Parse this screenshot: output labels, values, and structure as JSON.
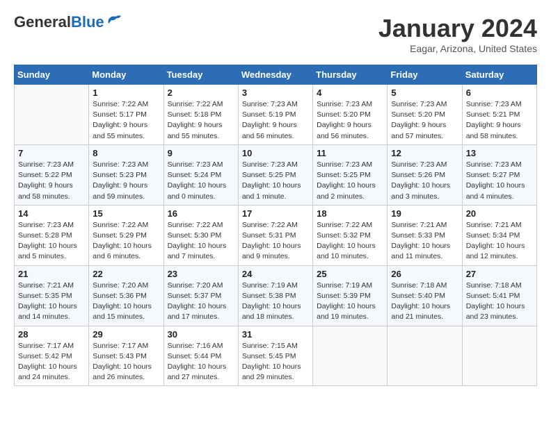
{
  "header": {
    "logo_general": "General",
    "logo_blue": "Blue",
    "title": "January 2024",
    "location": "Eagar, Arizona, United States"
  },
  "calendar": {
    "days_of_week": [
      "Sunday",
      "Monday",
      "Tuesday",
      "Wednesday",
      "Thursday",
      "Friday",
      "Saturday"
    ],
    "weeks": [
      [
        {
          "day": "",
          "info": ""
        },
        {
          "day": "1",
          "info": "Sunrise: 7:22 AM\nSunset: 5:17 PM\nDaylight: 9 hours\nand 55 minutes."
        },
        {
          "day": "2",
          "info": "Sunrise: 7:22 AM\nSunset: 5:18 PM\nDaylight: 9 hours\nand 55 minutes."
        },
        {
          "day": "3",
          "info": "Sunrise: 7:23 AM\nSunset: 5:19 PM\nDaylight: 9 hours\nand 56 minutes."
        },
        {
          "day": "4",
          "info": "Sunrise: 7:23 AM\nSunset: 5:20 PM\nDaylight: 9 hours\nand 56 minutes."
        },
        {
          "day": "5",
          "info": "Sunrise: 7:23 AM\nSunset: 5:20 PM\nDaylight: 9 hours\nand 57 minutes."
        },
        {
          "day": "6",
          "info": "Sunrise: 7:23 AM\nSunset: 5:21 PM\nDaylight: 9 hours\nand 58 minutes."
        }
      ],
      [
        {
          "day": "7",
          "info": "Sunrise: 7:23 AM\nSunset: 5:22 PM\nDaylight: 9 hours\nand 58 minutes."
        },
        {
          "day": "8",
          "info": "Sunrise: 7:23 AM\nSunset: 5:23 PM\nDaylight: 9 hours\nand 59 minutes."
        },
        {
          "day": "9",
          "info": "Sunrise: 7:23 AM\nSunset: 5:24 PM\nDaylight: 10 hours\nand 0 minutes."
        },
        {
          "day": "10",
          "info": "Sunrise: 7:23 AM\nSunset: 5:25 PM\nDaylight: 10 hours\nand 1 minute."
        },
        {
          "day": "11",
          "info": "Sunrise: 7:23 AM\nSunset: 5:25 PM\nDaylight: 10 hours\nand 2 minutes."
        },
        {
          "day": "12",
          "info": "Sunrise: 7:23 AM\nSunset: 5:26 PM\nDaylight: 10 hours\nand 3 minutes."
        },
        {
          "day": "13",
          "info": "Sunrise: 7:23 AM\nSunset: 5:27 PM\nDaylight: 10 hours\nand 4 minutes."
        }
      ],
      [
        {
          "day": "14",
          "info": "Sunrise: 7:23 AM\nSunset: 5:28 PM\nDaylight: 10 hours\nand 5 minutes."
        },
        {
          "day": "15",
          "info": "Sunrise: 7:22 AM\nSunset: 5:29 PM\nDaylight: 10 hours\nand 6 minutes."
        },
        {
          "day": "16",
          "info": "Sunrise: 7:22 AM\nSunset: 5:30 PM\nDaylight: 10 hours\nand 7 minutes."
        },
        {
          "day": "17",
          "info": "Sunrise: 7:22 AM\nSunset: 5:31 PM\nDaylight: 10 hours\nand 9 minutes."
        },
        {
          "day": "18",
          "info": "Sunrise: 7:22 AM\nSunset: 5:32 PM\nDaylight: 10 hours\nand 10 minutes."
        },
        {
          "day": "19",
          "info": "Sunrise: 7:21 AM\nSunset: 5:33 PM\nDaylight: 10 hours\nand 11 minutes."
        },
        {
          "day": "20",
          "info": "Sunrise: 7:21 AM\nSunset: 5:34 PM\nDaylight: 10 hours\nand 12 minutes."
        }
      ],
      [
        {
          "day": "21",
          "info": "Sunrise: 7:21 AM\nSunset: 5:35 PM\nDaylight: 10 hours\nand 14 minutes."
        },
        {
          "day": "22",
          "info": "Sunrise: 7:20 AM\nSunset: 5:36 PM\nDaylight: 10 hours\nand 15 minutes."
        },
        {
          "day": "23",
          "info": "Sunrise: 7:20 AM\nSunset: 5:37 PM\nDaylight: 10 hours\nand 17 minutes."
        },
        {
          "day": "24",
          "info": "Sunrise: 7:19 AM\nSunset: 5:38 PM\nDaylight: 10 hours\nand 18 minutes."
        },
        {
          "day": "25",
          "info": "Sunrise: 7:19 AM\nSunset: 5:39 PM\nDaylight: 10 hours\nand 19 minutes."
        },
        {
          "day": "26",
          "info": "Sunrise: 7:18 AM\nSunset: 5:40 PM\nDaylight: 10 hours\nand 21 minutes."
        },
        {
          "day": "27",
          "info": "Sunrise: 7:18 AM\nSunset: 5:41 PM\nDaylight: 10 hours\nand 23 minutes."
        }
      ],
      [
        {
          "day": "28",
          "info": "Sunrise: 7:17 AM\nSunset: 5:42 PM\nDaylight: 10 hours\nand 24 minutes."
        },
        {
          "day": "29",
          "info": "Sunrise: 7:17 AM\nSunset: 5:43 PM\nDaylight: 10 hours\nand 26 minutes."
        },
        {
          "day": "30",
          "info": "Sunrise: 7:16 AM\nSunset: 5:44 PM\nDaylight: 10 hours\nand 27 minutes."
        },
        {
          "day": "31",
          "info": "Sunrise: 7:15 AM\nSunset: 5:45 PM\nDaylight: 10 hours\nand 29 minutes."
        },
        {
          "day": "",
          "info": ""
        },
        {
          "day": "",
          "info": ""
        },
        {
          "day": "",
          "info": ""
        }
      ]
    ]
  }
}
